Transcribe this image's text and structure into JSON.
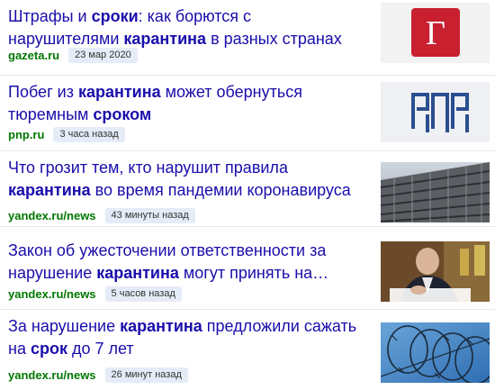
{
  "news": [
    {
      "title_parts": [
        {
          "text": "Штрафы и ",
          "bold": false
        },
        {
          "text": "сроки",
          "bold": true
        },
        {
          "text": ": как борются с нарушителями ",
          "bold": false
        },
        {
          "text": "карантина",
          "bold": true
        },
        {
          "text": " в разных странах",
          "bold": false
        }
      ],
      "source": "gazeta.ru",
      "time": "23 мар 2020",
      "thumb_icon": "gazeta-logo",
      "thumb_letter": "Г"
    },
    {
      "title_parts": [
        {
          "text": "Побег из ",
          "bold": false
        },
        {
          "text": "карантина",
          "bold": true
        },
        {
          "text": " может обернуться тюремным ",
          "bold": false
        },
        {
          "text": "сроком",
          "bold": true
        }
      ],
      "source": "pnp.ru",
      "time": "3 часа назад",
      "thumb_icon": "pnp-logo"
    },
    {
      "title_parts": [
        {
          "text": "Что грозит тем, кто нарушит правила ",
          "bold": false
        },
        {
          "text": "карантина",
          "bold": true
        },
        {
          "text": " во время пандемии коронавируса",
          "bold": false
        }
      ],
      "source": "yandex.ru/news",
      "time": "43 минуты назад",
      "thumb_icon": "building-photo"
    },
    {
      "title_parts": [
        {
          "text": "Закон об ужесточении ответственности за нарушение ",
          "bold": false
        },
        {
          "text": "карантина",
          "bold": true
        },
        {
          "text": " могут принять на…",
          "bold": false
        }
      ],
      "source": "yandex.ru/news",
      "time": "5 часов назад",
      "thumb_icon": "official-photo"
    },
    {
      "title_parts": [
        {
          "text": "За нарушение ",
          "bold": false
        },
        {
          "text": "карантина",
          "bold": true
        },
        {
          "text": " предложили сажать на ",
          "bold": false
        },
        {
          "text": "срок",
          "bold": true
        },
        {
          "text": " до 7 лет",
          "bold": false
        }
      ],
      "source": "yandex.ru/news",
      "time": "26 минут назад",
      "thumb_icon": "barbed-wire-photo"
    }
  ],
  "colors": {
    "link": "#1a0dab",
    "source": "#007700",
    "badge_bg": "#e5ecf7",
    "gazeta_red": "#c8202f",
    "pnp_blue": "#2a4f8f"
  }
}
